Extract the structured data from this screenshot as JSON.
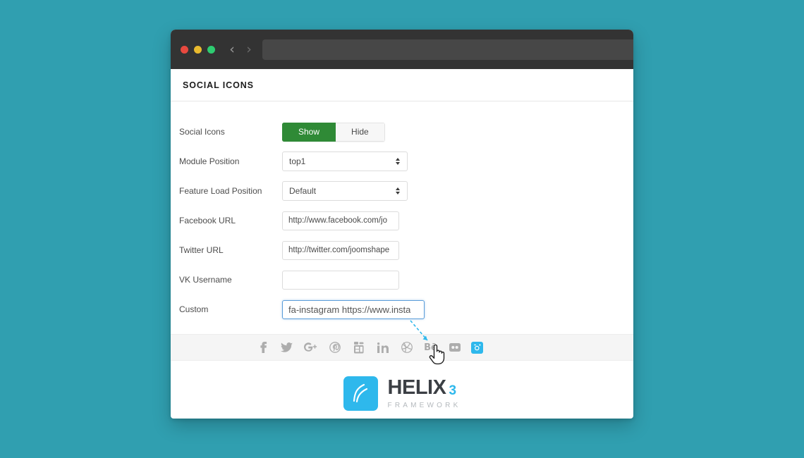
{
  "browser": {
    "traffic_lights": [
      {
        "name": "close",
        "color": "#e8493f"
      },
      {
        "name": "minimize",
        "color": "#e9ba2e"
      },
      {
        "name": "zoom",
        "color": "#2ecc71"
      }
    ],
    "back_glyph": "‹",
    "forward_glyph": "›",
    "url_value": "",
    "url_placeholder": ""
  },
  "page": {
    "title": "SOCIAL ICONS"
  },
  "form": {
    "rows": [
      {
        "label": "Social Icons",
        "type": "toggle"
      },
      {
        "label": "Module Position",
        "type": "select",
        "value": "top1"
      },
      {
        "label": "Feature Load Position",
        "type": "select",
        "value": "Default"
      },
      {
        "label": "Facebook URL",
        "type": "text",
        "value": "http://www.facebook.com/jo"
      },
      {
        "label": "Twitter URL",
        "type": "text",
        "value": "http://twitter.com/joomshape"
      },
      {
        "label": "VK Username",
        "type": "text",
        "value": ""
      },
      {
        "label": "Custom",
        "type": "text",
        "value": "fa-instagram https://www.insta"
      }
    ],
    "toggle": {
      "on_label": "Show",
      "off_label": "Hide",
      "selected": "Show",
      "on_color": "#2f8a36"
    }
  },
  "social": {
    "icons": [
      {
        "name": "facebook-icon",
        "glyph": "f"
      },
      {
        "name": "twitter-icon",
        "glyph": ""
      },
      {
        "name": "google-plus-icon",
        "glyph": ""
      },
      {
        "name": "pinterest-icon",
        "glyph": ""
      },
      {
        "name": "youtube-icon",
        "glyph": ""
      },
      {
        "name": "linkedin-icon",
        "glyph": "in"
      },
      {
        "name": "dribbble-icon",
        "glyph": ""
      },
      {
        "name": "behance-icon",
        "glyph": "Bē"
      },
      {
        "name": "flickr-icon",
        "glyph": ""
      },
      {
        "name": "instagram-icon",
        "glyph": ""
      }
    ],
    "highlight_color": "#2eb8ec",
    "strip_color": "#f5f5f5"
  },
  "logo": {
    "name": "HELIX",
    "version": "3",
    "subtitle": "FRAMEWORK",
    "accent": "#2eb8ec"
  },
  "theme": {
    "background": "#309fb0",
    "titlebar": "#333333",
    "focus_border": "#5b9dd9"
  }
}
